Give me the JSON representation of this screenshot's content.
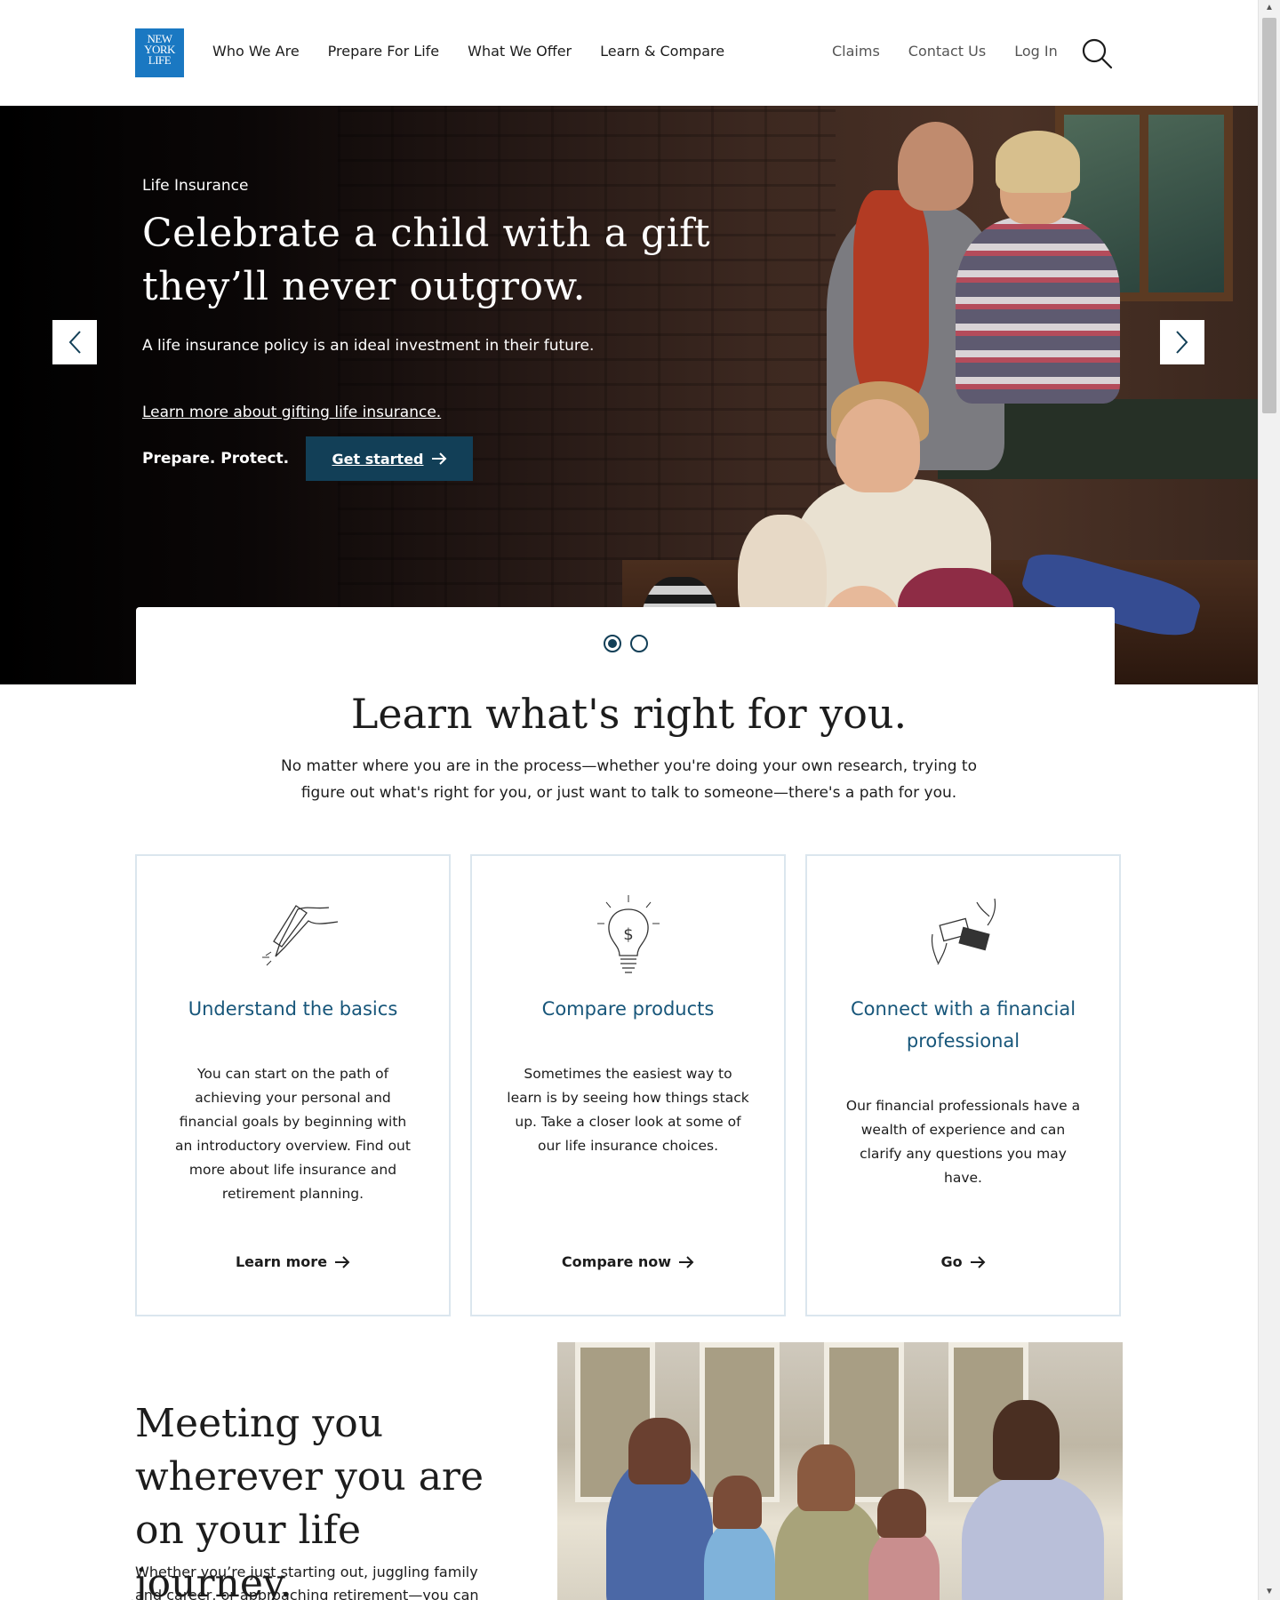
{
  "header": {
    "logo": "NEW YORK LIFE",
    "primary_nav": [
      "Who We Are",
      "Prepare For Life",
      "What We Offer",
      "Learn & Compare"
    ],
    "secondary_nav": [
      "Claims",
      "Contact Us",
      "Log In"
    ]
  },
  "hero": {
    "eyebrow": "Life Insurance",
    "title": "Celebrate a child with a gift they’ll never outgrow.",
    "subtitle": "A life insurance policy is an ideal investment in their future.",
    "link": "Learn more about gifting life insurance.",
    "tagline": "Prepare. Protect.",
    "cta": "Get started",
    "slides_total": 2,
    "active_slide": 1
  },
  "learn": {
    "title": "Learn what's right for you.",
    "subtitle": "No matter where you are in the process—whether you're doing your own research, trying to figure out what's right for you, or just want to talk to someone—there's a path for you.",
    "cards": [
      {
        "icon": "pen-hand-icon",
        "title": "Understand the basics",
        "body": "You can start on the path of achieving your personal and financial goals by beginning with an introductory overview.  Find out more about life insurance and retirement planning.",
        "cta": "Learn more"
      },
      {
        "icon": "lightbulb-dollar-icon",
        "title": "Compare products",
        "body": "Sometimes the easiest way to learn is by seeing how things stack up. Take a closer look at some of our life insurance choices.",
        "cta": "Compare now"
      },
      {
        "icon": "business-card-exchange-icon",
        "title": "Connect with a financial professional",
        "body": "Our financial professionals have a wealth of experience and can clarify any questions you may have.",
        "cta": "Go"
      }
    ]
  },
  "meeting": {
    "title": "Meeting you wherever you are on your life journey.",
    "body": "Whether you’re just starting out, juggling family and career, or approaching retirement—you can rely on our"
  },
  "colors": {
    "brand_blue": "#1a78c2",
    "primary_button": "#123f57",
    "card_heading": "#17567a",
    "card_border": "#dbe6ee"
  }
}
